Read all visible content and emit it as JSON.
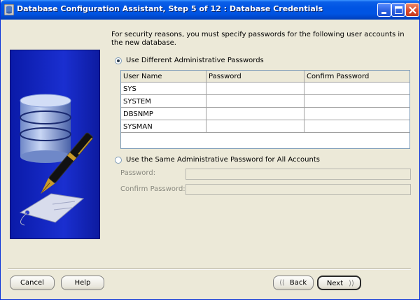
{
  "window": {
    "title": "Database Configuration Assistant, Step 5 of 12 : Database Credentials"
  },
  "intro_text": "For security reasons, you must specify passwords for the following user accounts in the new database.",
  "option_different": {
    "label": "Use Different Administrative Passwords",
    "selected": true
  },
  "grid": {
    "columns": [
      "User Name",
      "Password",
      "Confirm Password"
    ],
    "rows": [
      {
        "user": "SYS",
        "password": "",
        "confirm": ""
      },
      {
        "user": "SYSTEM",
        "password": "",
        "confirm": ""
      },
      {
        "user": "DBSNMP",
        "password": "",
        "confirm": ""
      },
      {
        "user": "SYSMAN",
        "password": "",
        "confirm": ""
      }
    ]
  },
  "option_same": {
    "label": "Use the Same Administrative Password for All Accounts",
    "selected": false
  },
  "fields": {
    "password_label": "Password:",
    "confirm_label": "Confirm Password:"
  },
  "buttons": {
    "cancel": "Cancel",
    "help": "Help",
    "back": "Back",
    "next": "Next"
  },
  "icons": {
    "app": "database-app-icon",
    "minimize": "minimize-icon",
    "maximize": "maximize-icon",
    "close": "close-icon",
    "back_arrow": "chevron-left-icon",
    "next_arrow": "chevron-right-icon"
  },
  "colors": {
    "titlebar": "#0054e3",
    "side_panel": "#1a2fd0",
    "window_bg": "#ece9d8"
  }
}
